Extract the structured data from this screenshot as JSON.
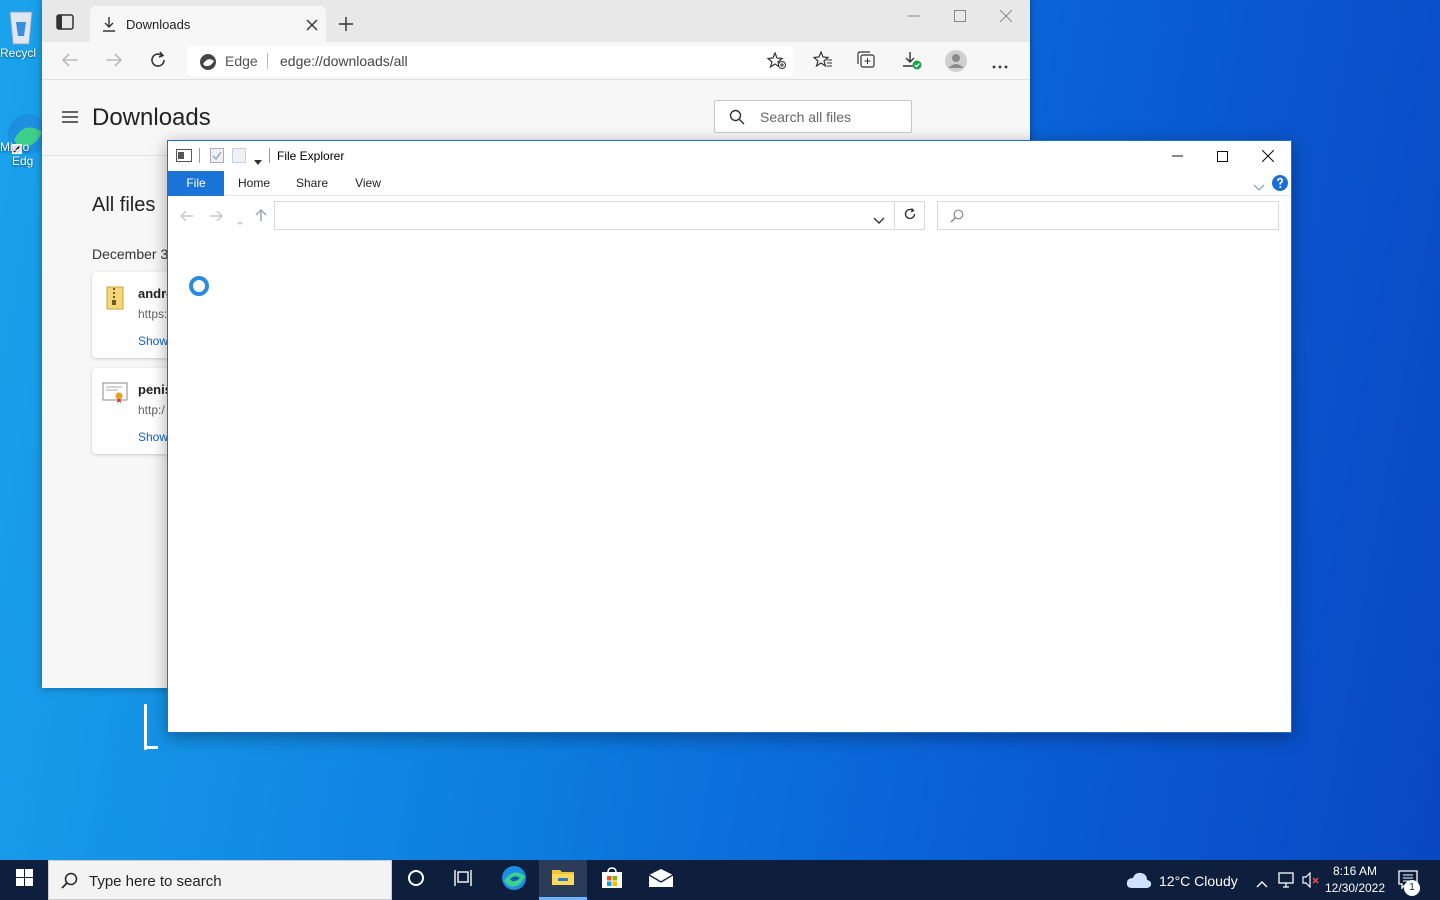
{
  "desktop": {
    "icons": [
      {
        "label": "Recycl",
        "icon": "recycle-bin-icon"
      },
      {
        "label": "Micro Edg",
        "line1": "Micro",
        "line2": "Edg",
        "icon": "edge-shortcut-icon"
      }
    ]
  },
  "edge": {
    "tab": {
      "title": "Downloads",
      "icon": "download-icon"
    },
    "address": {
      "site_label": "Edge",
      "url": "edge://downloads/all"
    },
    "page": {
      "title": "Downloads",
      "search_placeholder": "Search all files",
      "section_title": "All files",
      "date_group": "December 3",
      "items": [
        {
          "name": "andro",
          "url": "https:",
          "action": "Show",
          "icon": "zip-file-icon"
        },
        {
          "name": "penis",
          "url": "http:/",
          "action": "Show",
          "icon": "certificate-file-icon"
        }
      ]
    }
  },
  "explorer": {
    "title": "File Explorer",
    "ribbon_tabs": [
      "File",
      "Home",
      "Share",
      "View"
    ],
    "address_value": "",
    "search_placeholder": "",
    "loading": true
  },
  "taskbar": {
    "search_placeholder": "Type here to search",
    "weather": "12°C  Cloudy",
    "time": "8:16 AM",
    "date": "12/30/2022",
    "notification_count": "1"
  },
  "colors": {
    "accent": "#1a73d6",
    "taskbar": "#0d1f3c",
    "desktop": "#0a5fd6"
  }
}
